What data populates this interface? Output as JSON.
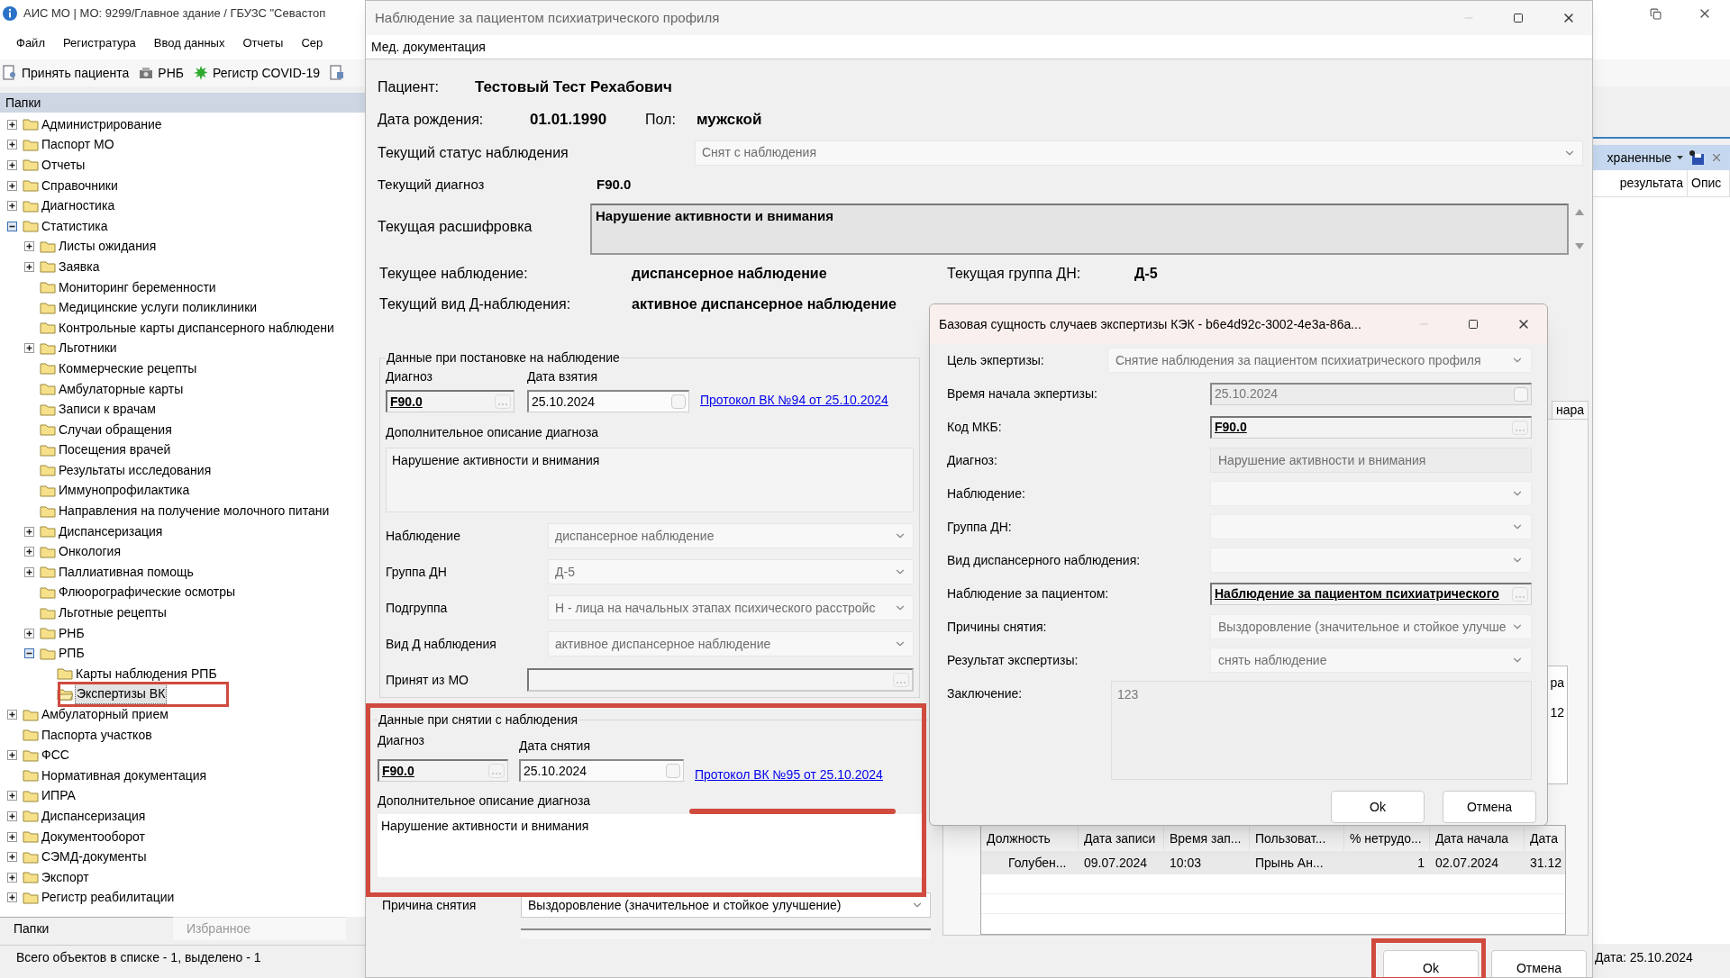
{
  "app": {
    "title": "АИС МО | МО: 9299/Главное здание / ГБУЗС \"Севастоп",
    "menu": [
      "Файл",
      "Регистратура",
      "Ввод данных",
      "Отчеты",
      "Сер"
    ],
    "toolbar": [
      {
        "label": "Принять пациента",
        "kind": "patient"
      },
      {
        "label": "РНБ",
        "kind": "device"
      },
      {
        "label": "Регистр COVID-19",
        "kind": "virus"
      }
    ],
    "folders_header": "Папки",
    "tree": [
      {
        "label": "Администрирование",
        "expandable": true,
        "expanded": false,
        "selected": false
      },
      {
        "label": "Паспорт МО",
        "expandable": true,
        "expanded": false,
        "selected": false
      },
      {
        "label": "Отчеты",
        "expandable": true,
        "expanded": false,
        "selected": false
      },
      {
        "label": "Справочники",
        "expandable": true,
        "expanded": false,
        "selected": false
      },
      {
        "label": "Диагностика",
        "expandable": true,
        "expanded": false,
        "selected": false
      },
      {
        "label": "Статистика",
        "expandable": true,
        "expanded": true,
        "selected": false,
        "children": [
          {
            "label": "Листы ожидания",
            "expandable": true,
            "expanded": false,
            "selected": false
          },
          {
            "label": "Заявка",
            "expandable": true,
            "expanded": false,
            "selected": false
          },
          {
            "label": "Мониторинг беременности",
            "selected": false
          },
          {
            "label": "Медицинские услуги поликлиники",
            "selected": false
          },
          {
            "label": "Контрольные карты диспансерного наблюдени",
            "selected": false
          },
          {
            "label": "Льготники",
            "expandable": true,
            "expanded": false,
            "selected": false
          },
          {
            "label": "Коммерческие рецепты",
            "selected": false
          },
          {
            "label": "Амбулаторные карты",
            "selected": false
          },
          {
            "label": "Записи к врачам",
            "selected": false
          },
          {
            "label": "Случаи обращения",
            "selected": false
          },
          {
            "label": "Посещения врачей",
            "selected": false
          },
          {
            "label": "Результаты исследования",
            "selected": false
          },
          {
            "label": "Иммунопрофилактика",
            "selected": false
          },
          {
            "label": "Направления на получение молочного питани",
            "selected": false
          },
          {
            "label": "Диспансеризация",
            "expandable": true,
            "expanded": false,
            "selected": false
          },
          {
            "label": "Онкология",
            "expandable": true,
            "expanded": false,
            "selected": false
          },
          {
            "label": "Паллиативная помощь",
            "expandable": true,
            "expanded": false,
            "selected": false
          },
          {
            "label": "Флюорографические осмотры",
            "selected": false
          },
          {
            "label": "Льготные рецепты",
            "selected": false
          },
          {
            "label": "РНБ",
            "expandable": true,
            "expanded": false,
            "selected": false
          },
          {
            "label": "РПБ",
            "expandable": true,
            "expanded": true,
            "selected": false,
            "children": [
              {
                "label": "Карты наблюдения РПБ",
                "selected": false
              },
              {
                "label": "Экспертизы ВК",
                "selected": true
              }
            ]
          }
        ]
      },
      {
        "label": "Амбулаторный прием",
        "expandable": true,
        "expanded": false,
        "selected": false
      },
      {
        "label": "Паспорта участков",
        "selected": false
      },
      {
        "label": "ФСС",
        "expandable": true,
        "expanded": false,
        "selected": false
      },
      {
        "label": "Нормативная документация",
        "selected": false
      },
      {
        "label": "ИПРА",
        "expandable": true,
        "expanded": false,
        "selected": false
      },
      {
        "label": "Диспансеризация",
        "expandable": true,
        "expanded": false,
        "selected": false
      },
      {
        "label": "Документооборот",
        "expandable": true,
        "expanded": false,
        "selected": false
      },
      {
        "label": "СЭМД-документы",
        "expandable": true,
        "expanded": false,
        "selected": false
      },
      {
        "label": "Экспорт",
        "expandable": true,
        "expanded": false,
        "selected": false
      },
      {
        "label": "Регистр реабилитации",
        "expandable": true,
        "expanded": false,
        "selected": false
      }
    ],
    "bottom_tabs": [
      {
        "label": "Папки",
        "selected": true
      },
      {
        "label": "Избранное",
        "selected": false
      }
    ],
    "status": "Всего объектов в списке - 1, выделено - 1",
    "right_fragment": {
      "filter": "храненные",
      "columns": [
        "результата",
        "Опис"
      ],
      "date": "Дата: 25.10.2024"
    }
  },
  "main_window": {
    "title": "Наблюдение за пациентом психиатрического профиля",
    "menu": "Мед. документация",
    "patient": {
      "label": "Пациент:",
      "value": "Тестовый Тест Рехабович"
    },
    "birth": {
      "label": "Дата рождения:",
      "value": "01.01.1990"
    },
    "sex": {
      "label": "Пол:",
      "value": "мужской"
    },
    "status": {
      "label": "Текущий статус наблюдения",
      "value": "Снят с наблюдения",
      "disabled": true
    },
    "diagnosis": {
      "label": "Текущий диагноз",
      "value": "F90.0"
    },
    "decoding": {
      "label": "Текущая расшифровка",
      "value": "Нарушение активности и внимания"
    },
    "observation": {
      "label": "Текущее наблюдение:",
      "value": "диспансерное наблюдение"
    },
    "dn_group": {
      "label": "Текущая группа ДН:",
      "value": "Д-5"
    },
    "d_kind": {
      "label": "Текущий вид Д-наблюдения:",
      "value": "активное диспансерное наблюдение"
    },
    "registration": {
      "title": "Данные при постановке на наблюдение",
      "diagnosis_label": "Диагноз",
      "diagnosis": "F90.0",
      "date_label": "Дата взятия",
      "date": "25.10.2024",
      "protocol": "Протокол ВК №94 от 25.10.2024",
      "description_label": "Дополнительное описание диагноза",
      "description": "Нарушение активности и внимания",
      "fields": [
        {
          "label": "Наблюдение",
          "value": "диспансерное наблюдение",
          "kind": "combo"
        },
        {
          "label": "Группа ДН",
          "value": "Д-5",
          "kind": "combo"
        },
        {
          "label": "Подгруппа",
          "value": "Н - лица на начальных этапах психического расстройс",
          "kind": "combo"
        },
        {
          "label": "Вид Д наблюдения",
          "value": "активное диспансерное наблюдение",
          "kind": "combo"
        },
        {
          "label": "Принят из МО",
          "kind": "lookup"
        }
      ]
    },
    "removal": {
      "title": "Данные при снятии с наблюдения",
      "diagnosis_label": "Диагноз",
      "diagnosis": "F90.0",
      "date_label": "Дата снятия",
      "date": "25.10.2024",
      "protocol": "Протокол ВК №95 от 25.10.2024",
      "description_label": "Дополнительное описание диагноза",
      "description": "Нарушение активности и внимания"
    },
    "removal_reason": {
      "label": "Причина снятия",
      "value": "Выздоровление (значительное и стойкое улучшение)",
      "disabled": false
    },
    "side_tab": "нара",
    "side_fragment": [
      "ра",
      "12"
    ],
    "grid": {
      "columns": [
        "Должность",
        "Дата записи",
        "Время зап...",
        "Пользоват...",
        "% нетрудо...",
        "Дата начала",
        "Дата"
      ],
      "rows": [
        [
          "Голубен...",
          "09.07.2024",
          "10:03",
          "Прынь Ан...",
          "1",
          "02.07.2024",
          "31.12"
        ]
      ]
    },
    "buttons": [
      "Ok",
      "Отмена"
    ]
  },
  "dialog": {
    "title": "Базовая сущность случаев экспертизы КЭК - b6e4d92c-3002-4e3a-86a...",
    "fields": [
      {
        "label": "Цель экпертизы:",
        "value": "Снятие наблюдения за пациентом психиатрического профиля",
        "kind": "combo",
        "wide": true
      },
      {
        "label": "Время начала экпертизы:",
        "value": "25.10.2024",
        "kind": "date",
        "wide": false
      },
      {
        "label": "Код МКБ:",
        "value": "F90.0",
        "kind": "lookup",
        "wide": false
      },
      {
        "label": "Диагноз:",
        "value": "Нарушение активности и внимания",
        "kind": "text",
        "wide": false
      },
      {
        "label": "Наблюдение:",
        "kind": "combo",
        "wide": false
      },
      {
        "label": "Группа ДН:",
        "kind": "combo",
        "wide": false
      },
      {
        "label": "Вид диспансерного наблюдения:",
        "kind": "combo",
        "wide": false
      },
      {
        "label": "Наблюдение за пациентом:",
        "value": "Наблюдение за пациентом психиатрического",
        "kind": "lookup",
        "wide": false
      },
      {
        "label": "Причины снятия:",
        "value": "Выздоровление (значительное и стойкое улучше",
        "kind": "combo",
        "wide": false
      },
      {
        "label": "Результат экспертизы:",
        "value": "снять наблюдение",
        "kind": "combo",
        "wide": false
      },
      {
        "label": "Заключение:",
        "value": "123",
        "kind": "memo",
        "wide": true
      }
    ],
    "buttons": [
      "Ok",
      "Отмена"
    ]
  }
}
